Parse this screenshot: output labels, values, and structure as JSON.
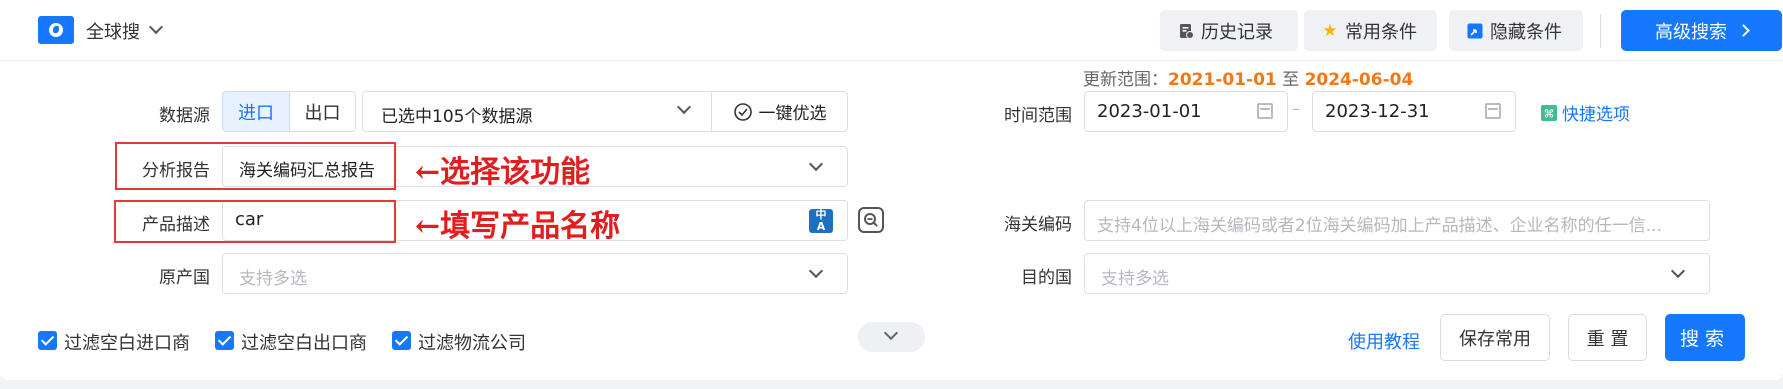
{
  "header": {
    "scope_label": "全球搜",
    "history_label": "历史记录",
    "common_conditions_label": "常用条件",
    "hide_conditions_label": "隐藏条件",
    "advanced_search_label": "高级搜索"
  },
  "update_range": {
    "prefix": "更新范围：",
    "start": "2021-01-01",
    "connector": "至",
    "end": "2024-06-04"
  },
  "form": {
    "datasource": {
      "label": "数据源",
      "import_label": "进口",
      "export_label": "出口",
      "selected_text": "已选中105个数据源",
      "one_click_label": "一键优选"
    },
    "time_range": {
      "label": "时间范围",
      "start": "2023-01-01",
      "separator": "–",
      "end": "2023-12-31",
      "quick_options_label": "快捷选项"
    },
    "analysis_report": {
      "label": "分析报告",
      "value": "海关编码汇总报告"
    },
    "product_desc": {
      "label": "产品描述",
      "value": "car"
    },
    "hs_code": {
      "label": "海关编码",
      "placeholder": "支持4位以上海关编码或者2位海关编码加上产品描述、企业名称的任一信..."
    },
    "origin_country": {
      "label": "原产国",
      "placeholder": "支持多选"
    },
    "destination_country": {
      "label": "目的国",
      "placeholder": "支持多选"
    }
  },
  "annotations": {
    "select_feature": "←选择该功能",
    "fill_product": "←填写产品名称"
  },
  "filters": [
    {
      "label": "过滤空白进口商",
      "checked": true
    },
    {
      "label": "过滤空白出口商",
      "checked": true
    },
    {
      "label": "过滤物流公司",
      "checked": true
    }
  ],
  "footer": {
    "tutorial_label": "使用教程",
    "save_common_label": "保存常用",
    "reset_label": "重 置",
    "search_label": "搜索"
  },
  "colors": {
    "primary": "#1677ff",
    "highlight_orange": "#f07818",
    "annotation_red": "#e11d1d"
  }
}
